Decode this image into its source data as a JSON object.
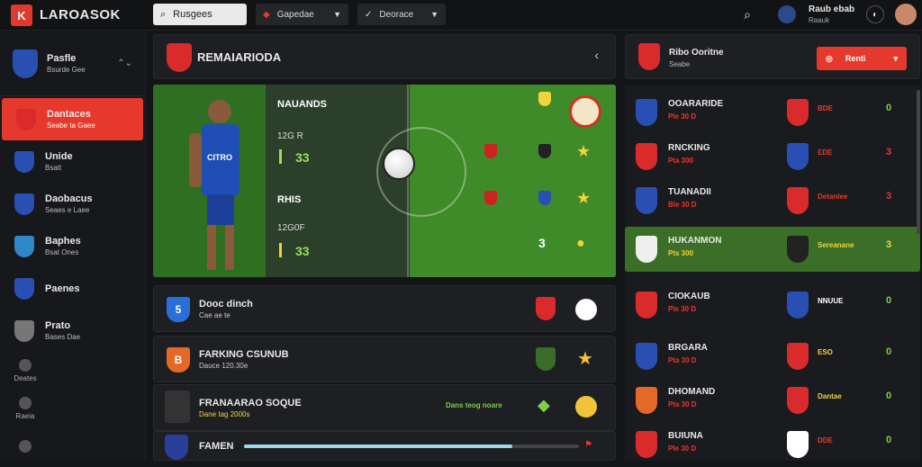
{
  "app": {
    "brand": "LAROASOK",
    "logo": "K"
  },
  "topbar": {
    "search_label": "Rusgees",
    "select1": "Gapedae",
    "select2": "Deorace",
    "user_name": "Raub ebab",
    "user_sub": "Raauk"
  },
  "sidebar": {
    "head_title": "Pasfle",
    "head_sub": "Bsurde Gee",
    "items": [
      {
        "title": "Dantaces",
        "sub": "Seabe ta Gaee",
        "color": "#d92b2b"
      },
      {
        "title": "Unide",
        "sub": "Bsatt",
        "color": "#2a4fb2"
      },
      {
        "title": "Daobacus",
        "sub": "Seaes e Laee",
        "color": "#2a4fb2"
      },
      {
        "title": "Baphes",
        "sub": "Bsat Ones",
        "color": "#2e88c8"
      },
      {
        "title": "Paenes",
        "sub": "",
        "color": "#2a4fb2"
      },
      {
        "title": "Prato",
        "sub": "Bases Dae",
        "color": "#777777"
      }
    ],
    "mini": [
      {
        "label": "Deates"
      },
      {
        "label": "Raeia"
      },
      {
        "label": ""
      }
    ]
  },
  "match": {
    "title": "REMAIARIODA",
    "p1_name": "NAUANDS",
    "p1_time": "12G R",
    "p1_val": "33",
    "p2_name": "RHIS",
    "p2_time": "12G0F",
    "p2_val": "33",
    "num1": "3",
    "jersey_text": "CITRO"
  },
  "rows": [
    {
      "title": "Dooc dinch",
      "sub": "Cae ae te",
      "icon": "5",
      "color": "#2a6fd8"
    },
    {
      "title": "FARKING CSUNUB",
      "sub": "Dauce 120.30e",
      "icon": "B",
      "color": "#e46826"
    },
    {
      "title": "FRANAARAO SOQUE",
      "sub": "Dane tag 2000s",
      "icon": "",
      "color": "#444444",
      "rank": "Dans teog noare"
    },
    {
      "title": "FAMEN",
      "sub": "",
      "icon": "",
      "color": "#2a3f9a"
    }
  ],
  "rightpanel": {
    "head_title": "Ribo Ooritne",
    "head_sub": "Seabe",
    "btn_label": "Renti",
    "teams": [
      {
        "name": "OOARARIDE",
        "score": "Ple 30 D",
        "right": "BDE",
        "status": "0",
        "c1": "#2a4fb2",
        "c2": "#d92b2b"
      },
      {
        "name": "RNCKING",
        "score": "Pta 300",
        "right": "EDE",
        "status": "3",
        "c1": "#d92b2b",
        "c2": "#2a4fb2"
      },
      {
        "name": "TUANADII",
        "score": "Ble 30 D",
        "right": "Detanlee",
        "status": "3",
        "c1": "#2a4fb2",
        "c2": "#d92b2b"
      },
      {
        "name": "HUKANMON",
        "score": "Pts 300",
        "right": "Sereanane",
        "status": "3",
        "c1": "#eeeeee",
        "c2": "#222222"
      },
      {
        "name": "CIOKAUB",
        "score": "Ple 30 D",
        "right": "NNUUE",
        "status": "0",
        "c1": "#d92b2b",
        "c2": "#2a4fb2"
      },
      {
        "name": "BRGARA",
        "score": "Pta 30 D",
        "right": "ESO",
        "status": "0",
        "c1": "#2a4fb2",
        "c2": "#d92b2b"
      },
      {
        "name": "DHOMAND",
        "score": "Pta 30 D",
        "right": "Dantae",
        "status": "0",
        "c1": "#e46826",
        "c2": "#d92b2b"
      },
      {
        "name": "BUIUNA",
        "score": "Ple 30 D",
        "right": "DDE",
        "status": "0",
        "c1": "#d92b2b",
        "c2": "#ffffff"
      }
    ]
  }
}
